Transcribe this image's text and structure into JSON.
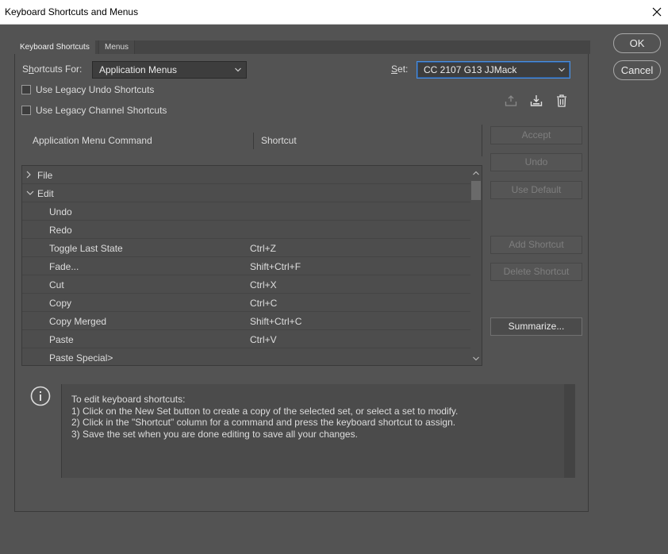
{
  "window": {
    "title": "Keyboard Shortcuts and Menus"
  },
  "tabs": [
    {
      "label": "Keyboard Shortcuts",
      "active": true
    },
    {
      "label": "Menus",
      "active": false
    }
  ],
  "shortcuts_for": {
    "label": "Shortcuts For:",
    "value": "Application Menus"
  },
  "set": {
    "label": "Set:",
    "value": "CC 2107 G13 JJMack"
  },
  "checkboxes": [
    {
      "label": "Use Legacy Undo Shortcuts",
      "checked": false
    },
    {
      "label": "Use Legacy Channel Shortcuts",
      "checked": false
    }
  ],
  "columns": {
    "command": "Application Menu Command",
    "shortcut": "Shortcut"
  },
  "rows": [
    {
      "command": "File",
      "shortcut": "",
      "type": "group",
      "expanded": false
    },
    {
      "command": "Edit",
      "shortcut": "",
      "type": "group",
      "expanded": true
    },
    {
      "command": "Undo",
      "shortcut": "",
      "type": "item"
    },
    {
      "command": "Redo",
      "shortcut": "",
      "type": "item"
    },
    {
      "command": "Toggle Last State",
      "shortcut": "Ctrl+Z",
      "type": "item"
    },
    {
      "command": "Fade...",
      "shortcut": "Shift+Ctrl+F",
      "type": "item"
    },
    {
      "command": "Cut",
      "shortcut": "Ctrl+X",
      "type": "item"
    },
    {
      "command": "Copy",
      "shortcut": "Ctrl+C",
      "type": "item"
    },
    {
      "command": "Copy Merged",
      "shortcut": "Shift+Ctrl+C",
      "type": "item"
    },
    {
      "command": "Paste",
      "shortcut": "Ctrl+V",
      "type": "item"
    },
    {
      "command": "Paste Special>",
      "shortcut": "",
      "type": "item"
    }
  ],
  "side_buttons": {
    "accept": "Accept",
    "undo": "Undo",
    "use_default": "Use Default",
    "add_shortcut": "Add Shortcut",
    "delete_shortcut": "Delete Shortcut",
    "summarize": "Summarize..."
  },
  "dialog_buttons": {
    "ok": "OK",
    "cancel": "Cancel"
  },
  "info": {
    "lines": [
      "To edit keyboard shortcuts:",
      "1) Click on the New Set button to create a copy of the selected set, or select a set to modify.",
      "2) Click in the \"Shortcut\" column for a command and press the keyboard shortcut to assign.",
      "3) Save the set when you are done editing to save all your changes."
    ]
  },
  "icons": {
    "close": "close-icon",
    "save_set": "save-set-icon",
    "new_set": "new-set-icon",
    "delete_set": "trash-icon",
    "info": "info-icon",
    "chevron_down": "chevron-down-icon",
    "chevron_right": "chevron-right-icon"
  },
  "colors": {
    "background": "#535353",
    "titlebar": "#ffffff",
    "focus": "#4a8fe0"
  }
}
